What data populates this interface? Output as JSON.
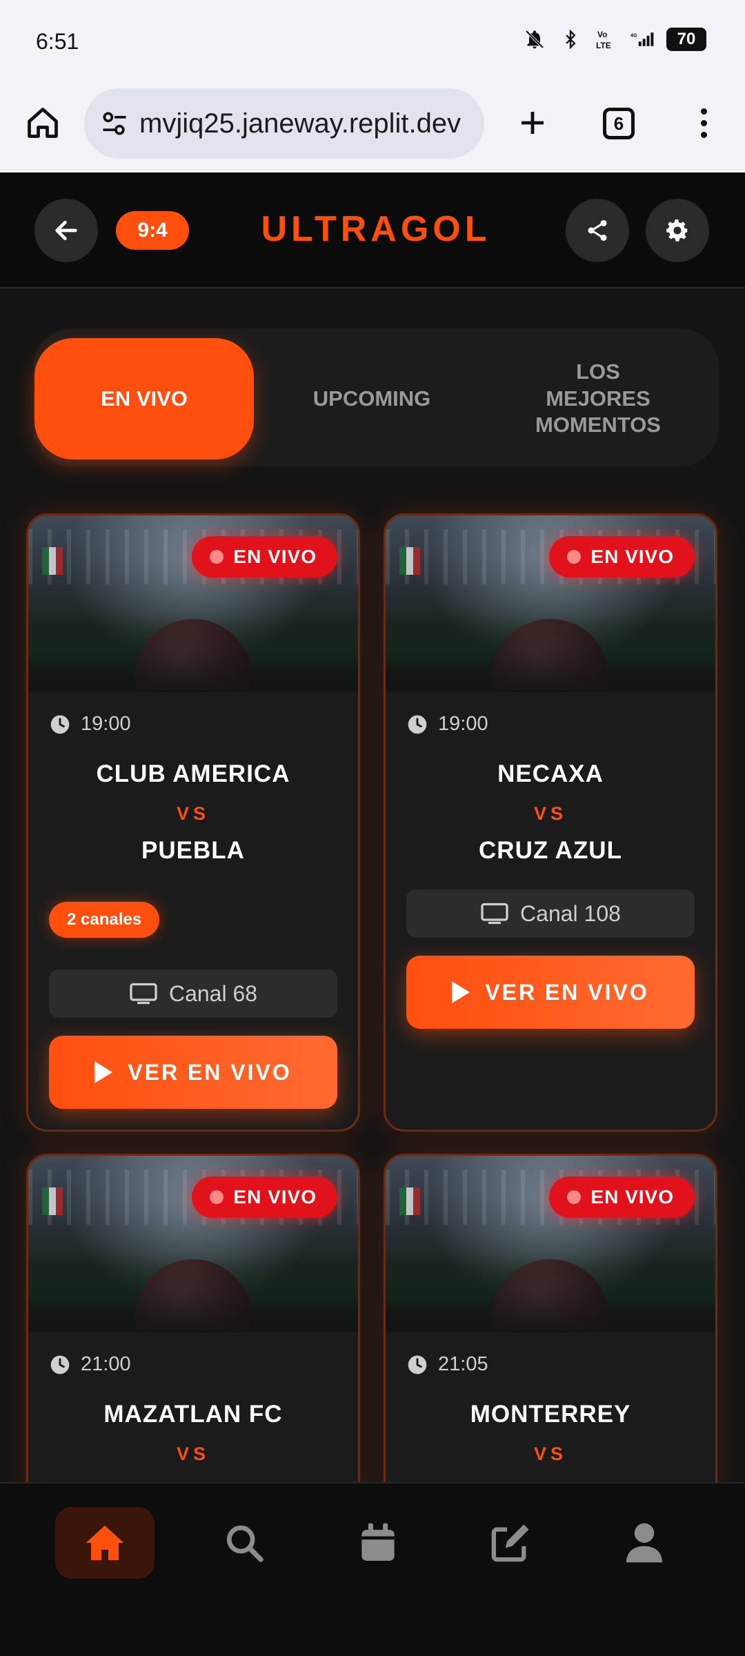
{
  "status_bar": {
    "time": "6:51",
    "battery": "70",
    "icons": [
      "bell-off-icon",
      "bluetooth-icon",
      "volte-icon",
      "signal-4g-icon",
      "battery-icon"
    ],
    "volte_label": "Vo\nLTE",
    "net_label": "4G"
  },
  "browser": {
    "url": "mvjiq25.janeway.replit.dev",
    "tab_count": "6"
  },
  "header": {
    "score": "9:4",
    "brand": "ULTRAGOL"
  },
  "tabs": [
    {
      "label": "EN VIVO",
      "active": true
    },
    {
      "label": "UPCOMING",
      "active": false
    },
    {
      "label": "LOS\nMEJORES\nMOMENTOS",
      "active": false
    }
  ],
  "matches": [
    {
      "live_label": "EN VIVO",
      "time": "19:00",
      "home": "CLUB AMERICA",
      "vs": "VS",
      "away": "PUEBLA",
      "channels_badge": "2 canales",
      "channel": "Canal 68",
      "watch_label": "VER EN VIVO"
    },
    {
      "live_label": "EN VIVO",
      "time": "19:00",
      "home": "NECAXA",
      "vs": "VS",
      "away": "CRUZ AZUL",
      "channel": "Canal 108",
      "watch_label": "VER EN VIVO"
    },
    {
      "live_label": "EN VIVO",
      "time": "21:00",
      "home": "MAZATLAN FC",
      "vs": "VS"
    },
    {
      "live_label": "EN VIVO",
      "time": "21:05",
      "home": "MONTERREY",
      "vs": "VS"
    }
  ],
  "bottom_nav": [
    {
      "icon": "home-icon",
      "active": true
    },
    {
      "icon": "search-icon",
      "active": false
    },
    {
      "icon": "calendar-icon",
      "active": false
    },
    {
      "icon": "edit-icon",
      "active": false
    },
    {
      "icon": "user-icon",
      "active": false
    }
  ],
  "colors": {
    "accent": "#ff4f0f",
    "live_red": "#e0121b",
    "background": "#141414"
  }
}
